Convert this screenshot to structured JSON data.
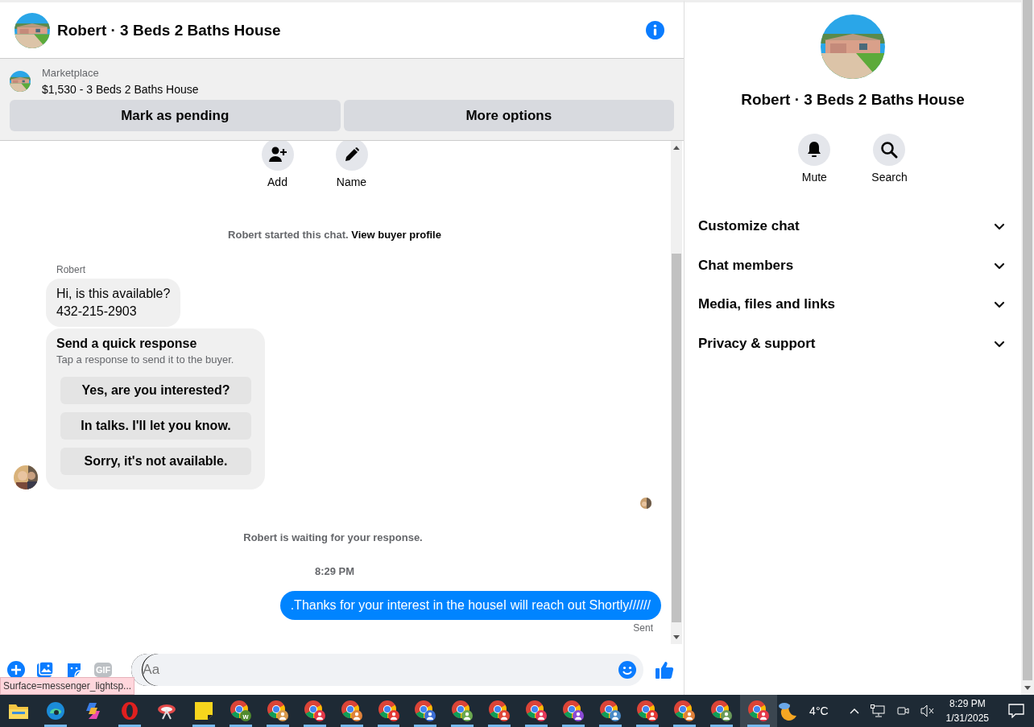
{
  "chat_header": {
    "title": "Robert · 3 Beds 2 Baths House"
  },
  "listing": {
    "source": "Marketplace",
    "item": "$1,530 - 3 Beds 2 Baths House",
    "buttons": [
      "Mark as pending",
      "More options"
    ]
  },
  "intro_actions": [
    {
      "kind": "add",
      "label": "Add"
    },
    {
      "kind": "name",
      "label": "Name"
    }
  ],
  "intro": {
    "text": "Robert started this chat.",
    "link": "View buyer profile"
  },
  "messages": [
    {
      "kind": "incoming",
      "sender": "Robert",
      "lines": [
        "Hi, is this available?",
        "432-215-2903"
      ]
    },
    {
      "kind": "quick_responses",
      "title": "Send a quick response",
      "subtitle": "Tap a response to send it to the buyer.",
      "options": [
        "Yes, are you interested?",
        "In talks. I'll let you know.",
        "Sorry, it's not available."
      ]
    },
    {
      "kind": "seen"
    },
    {
      "kind": "notice",
      "text": "Robert is waiting for your response."
    },
    {
      "kind": "time",
      "text": "8:29 PM"
    },
    {
      "kind": "outgoing",
      "text": ".Thanks for your interest in the houseI will reach out Shortly//////",
      "status": "Sent"
    }
  ],
  "composer": {
    "gif": "GIF",
    "placeholder": "Aa"
  },
  "status_tooltip": "Surface=messenger_lightsp...",
  "details": {
    "title": "Robert · 3 Beds 2 Baths House",
    "actions": [
      {
        "kind": "mute",
        "label": "Mute"
      },
      {
        "kind": "search",
        "label": "Search"
      }
    ],
    "sections": [
      {
        "label": "Customize chat",
        "expanded": false
      },
      {
        "label": "Chat members",
        "expanded": false
      },
      {
        "label": "Media, files and links",
        "expanded": false
      },
      {
        "label": "Privacy & support",
        "expanded": false
      }
    ]
  },
  "taskbar": {
    "apps": [
      {
        "kind": "explorer",
        "running": false,
        "selected": false
      },
      {
        "kind": "edge",
        "running": true,
        "selected": false
      },
      {
        "kind": "copilot",
        "running": false,
        "selected": false
      },
      {
        "kind": "opera",
        "running": true,
        "selected": false
      },
      {
        "kind": "snipping",
        "running": false,
        "selected": false
      },
      {
        "kind": "notes",
        "running": true,
        "selected": false
      },
      {
        "kind": "chrome",
        "running": true,
        "selected": false,
        "color": "#4f8a2f",
        "letter": "w"
      },
      {
        "kind": "chrome",
        "running": true,
        "selected": false,
        "color": "#d79a4e"
      },
      {
        "kind": "chrome",
        "running": true,
        "selected": false,
        "color": "#e5394a"
      },
      {
        "kind": "chrome",
        "running": true,
        "selected": false,
        "color": "#e0823a"
      },
      {
        "kind": "chrome",
        "running": true,
        "selected": false,
        "color": "#e53935"
      },
      {
        "kind": "chrome",
        "running": true,
        "selected": false,
        "color": "#3d6fd6"
      },
      {
        "kind": "chrome",
        "running": true,
        "selected": false,
        "color": "#6aa84f"
      },
      {
        "kind": "chrome",
        "running": true,
        "selected": false,
        "color": "#e0483a"
      },
      {
        "kind": "chrome",
        "running": true,
        "selected": false,
        "color": "#e5395a"
      },
      {
        "kind": "chrome",
        "running": true,
        "selected": false,
        "color": "#8a4ad6"
      },
      {
        "kind": "chrome",
        "running": true,
        "selected": false,
        "color": "#4a8ac6"
      },
      {
        "kind": "chrome",
        "running": true,
        "selected": false,
        "color": "#e53935"
      },
      {
        "kind": "chrome",
        "running": true,
        "selected": false,
        "color": "#e0803a"
      },
      {
        "kind": "chrome",
        "running": true,
        "selected": false,
        "color": "#6a9a5a"
      },
      {
        "kind": "chrome",
        "running": true,
        "selected": true,
        "color": "#e5394a"
      }
    ],
    "temperature": "4°C",
    "time": "8:29 PM",
    "date": "1/31/2025"
  }
}
